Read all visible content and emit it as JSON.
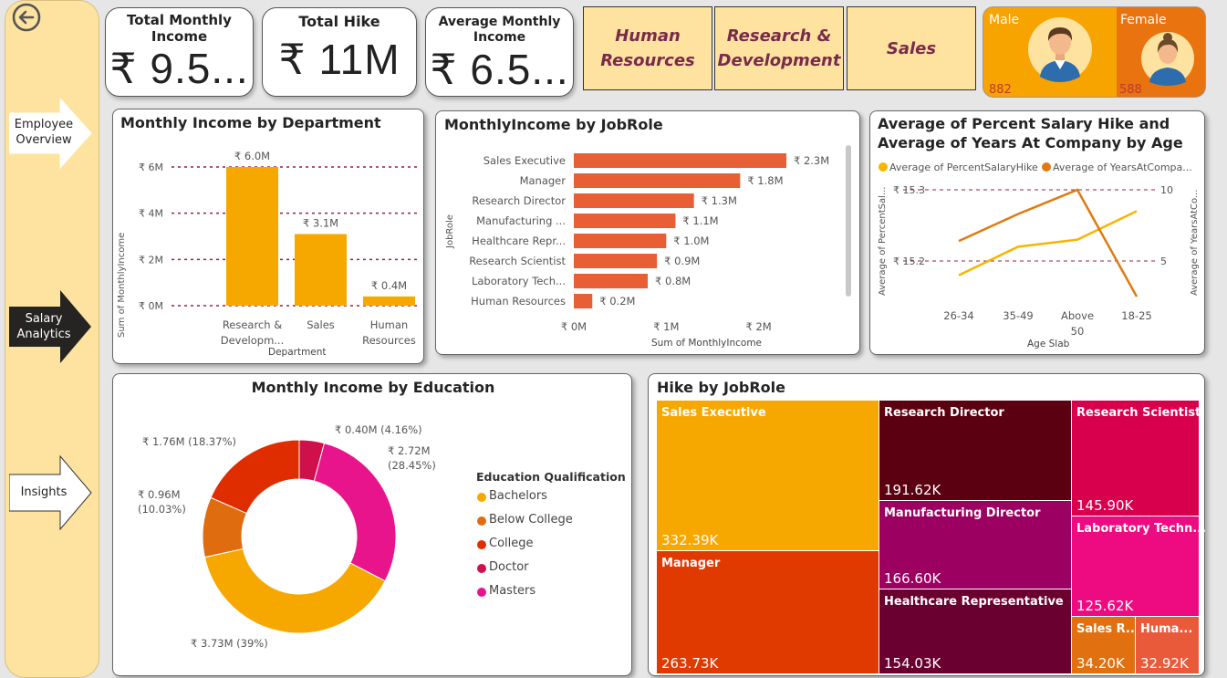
{
  "nav": {
    "items": [
      {
        "label": "Employee Overview",
        "active": false
      },
      {
        "label": "Salary Analytics",
        "active": true
      },
      {
        "label": "Insights",
        "active": false
      }
    ]
  },
  "kpis": [
    {
      "title": "Total Monthly Income",
      "value": "₹ 9.5..."
    },
    {
      "title": "Total Hike",
      "value": "₹ 11M"
    },
    {
      "title": "Average Monthly Income",
      "value": "₹ 6.5..."
    }
  ],
  "departments": [
    "Human Resources",
    "Research & Development",
    "Sales"
  ],
  "gender": {
    "male": {
      "label": "Male",
      "count": "882"
    },
    "female": {
      "label": "Female",
      "count": "588"
    }
  },
  "dept_chart": {
    "title": "Monthly Income by Department",
    "xlabel": "Department",
    "ylabel": "Sum of MonthlyIncome",
    "yticks": [
      "₹ 0M",
      "₹ 2M",
      "₹ 4M",
      "₹ 6M"
    ],
    "categories": [
      "Research & Developm...",
      "Sales",
      "Human Resources"
    ],
    "labels": [
      "₹ 6.0M",
      "₹ 3.1M",
      "₹ 0.4M"
    ]
  },
  "jobrole_chart": {
    "title": "MonthlyIncome by JobRole",
    "xlabel": "Sum of MonthlyIncome",
    "ylabel": "JobRole",
    "xticks": [
      "₹ 0M",
      "₹ 1M",
      "₹ 2M"
    ],
    "categories": [
      "Sales Executive",
      "Manager",
      "Research Director",
      "Manufacturing ...",
      "Healthcare Repr...",
      "Research Scientist",
      "Laboratory Tech...",
      "Human Resources"
    ],
    "labels": [
      "₹ 2.3M",
      "₹ 1.8M",
      "₹ 1.3M",
      "₹ 1.1M",
      "₹ 1.0M",
      "₹ 0.9M",
      "₹ 0.8M",
      "₹ 0.2M"
    ]
  },
  "age_chart": {
    "title": "Average of Percent Salary Hike and Average of Years At Company by Age",
    "legend": [
      "Average of PercentSalaryHike",
      "Average of YearsAtCompa..."
    ],
    "xlabel": "Age Slab",
    "ylabel_left": "Average of PercentSal...",
    "ylabel_right": "Average of YearsAtCo...",
    "yticks_left": [
      "₹ 15.3",
      "₹ 15.2"
    ],
    "yticks_right": [
      "10",
      "5"
    ],
    "categories": [
      "26-34",
      "35-49",
      "Above 50",
      "18-25"
    ]
  },
  "edu_chart": {
    "title": "Monthly Income by Education",
    "legend_title": "Education Qualification",
    "legend": [
      "Bachelors",
      "Below College",
      "College",
      "Doctor",
      "Masters"
    ],
    "slice_labels": [
      "₹ 3.73M (39%)",
      "₹ 0.96M (10.03%)",
      "₹ 1.76M (18.37%)",
      "₹ 0.40M (4.16%)",
      "₹ 2.72M (28.45%)"
    ]
  },
  "hike_chart": {
    "title": "Hike by JobRole",
    "cells": [
      {
        "name": "Sales Executive",
        "value": "332.39K"
      },
      {
        "name": "Manager",
        "value": "263.73K"
      },
      {
        "name": "Research Director",
        "value": "191.62K"
      },
      {
        "name": "Manufacturing Director",
        "value": "166.60K"
      },
      {
        "name": "Healthcare Representative",
        "value": "154.03K"
      },
      {
        "name": "Research Scientist",
        "value": "145.90K"
      },
      {
        "name": "Laboratory Techn...",
        "value": "125.62K"
      },
      {
        "name": "Sales R...",
        "value": "34.20K"
      },
      {
        "name": "Huma...",
        "value": "32.92K"
      }
    ]
  },
  "chart_data": [
    {
      "type": "bar",
      "title": "Monthly Income by Department",
      "categories": [
        "Research & Development",
        "Sales",
        "Human Resources"
      ],
      "values": [
        6.0,
        3.1,
        0.4
      ],
      "xlabel": "Department",
      "ylabel": "Sum of MonthlyIncome",
      "ylim": [
        0,
        6
      ]
    },
    {
      "type": "bar",
      "title": "MonthlyIncome by JobRole",
      "categories": [
        "Sales Executive",
        "Manager",
        "Research Director",
        "Manufacturing Director",
        "Healthcare Representative",
        "Research Scientist",
        "Laboratory Technician",
        "Human Resources"
      ],
      "values": [
        2.3,
        1.8,
        1.3,
        1.1,
        1.0,
        0.9,
        0.8,
        0.2
      ],
      "xlabel": "Sum of MonthlyIncome",
      "ylabel": "JobRole",
      "xlim": [
        0,
        2.3
      ]
    },
    {
      "type": "line",
      "title": "Average of Percent Salary Hike and Average of Years At Company by Age",
      "categories": [
        "26-34",
        "35-49",
        "Above 50",
        "18-25"
      ],
      "series": [
        {
          "name": "Average of PercentSalaryHike",
          "values": [
            15.18,
            15.22,
            15.23,
            15.27
          ]
        },
        {
          "name": "Average of YearsAtCompany",
          "values": [
            6.4,
            8.3,
            10.0,
            2.5
          ]
        }
      ],
      "xlabel": "Age Slab",
      "ylim_left": [
        15.15,
        15.32
      ],
      "ylim_right": [
        2,
        10
      ]
    },
    {
      "type": "pie",
      "title": "Monthly Income by Education",
      "categories": [
        "Bachelors",
        "Below College",
        "College",
        "Doctor",
        "Masters"
      ],
      "values": [
        3.73,
        0.96,
        1.76,
        0.4,
        2.72
      ],
      "percents": [
        39,
        10.03,
        18.37,
        4.16,
        28.45
      ]
    },
    {
      "type": "table",
      "title": "Hike by JobRole",
      "categories": [
        "Sales Executive",
        "Manager",
        "Research Director",
        "Manufacturing Director",
        "Healthcare Representative",
        "Research Scientist",
        "Laboratory Technician",
        "Sales Representative",
        "Human Resources"
      ],
      "values": [
        332.39,
        263.73,
        191.62,
        166.6,
        154.03,
        145.9,
        125.62,
        34.2,
        32.92
      ]
    }
  ],
  "colors": {
    "accent": "#f7a800",
    "bar_orange": "#e85f35",
    "sidebar": "#fde39f",
    "dept_text": "#7a2a4a"
  }
}
